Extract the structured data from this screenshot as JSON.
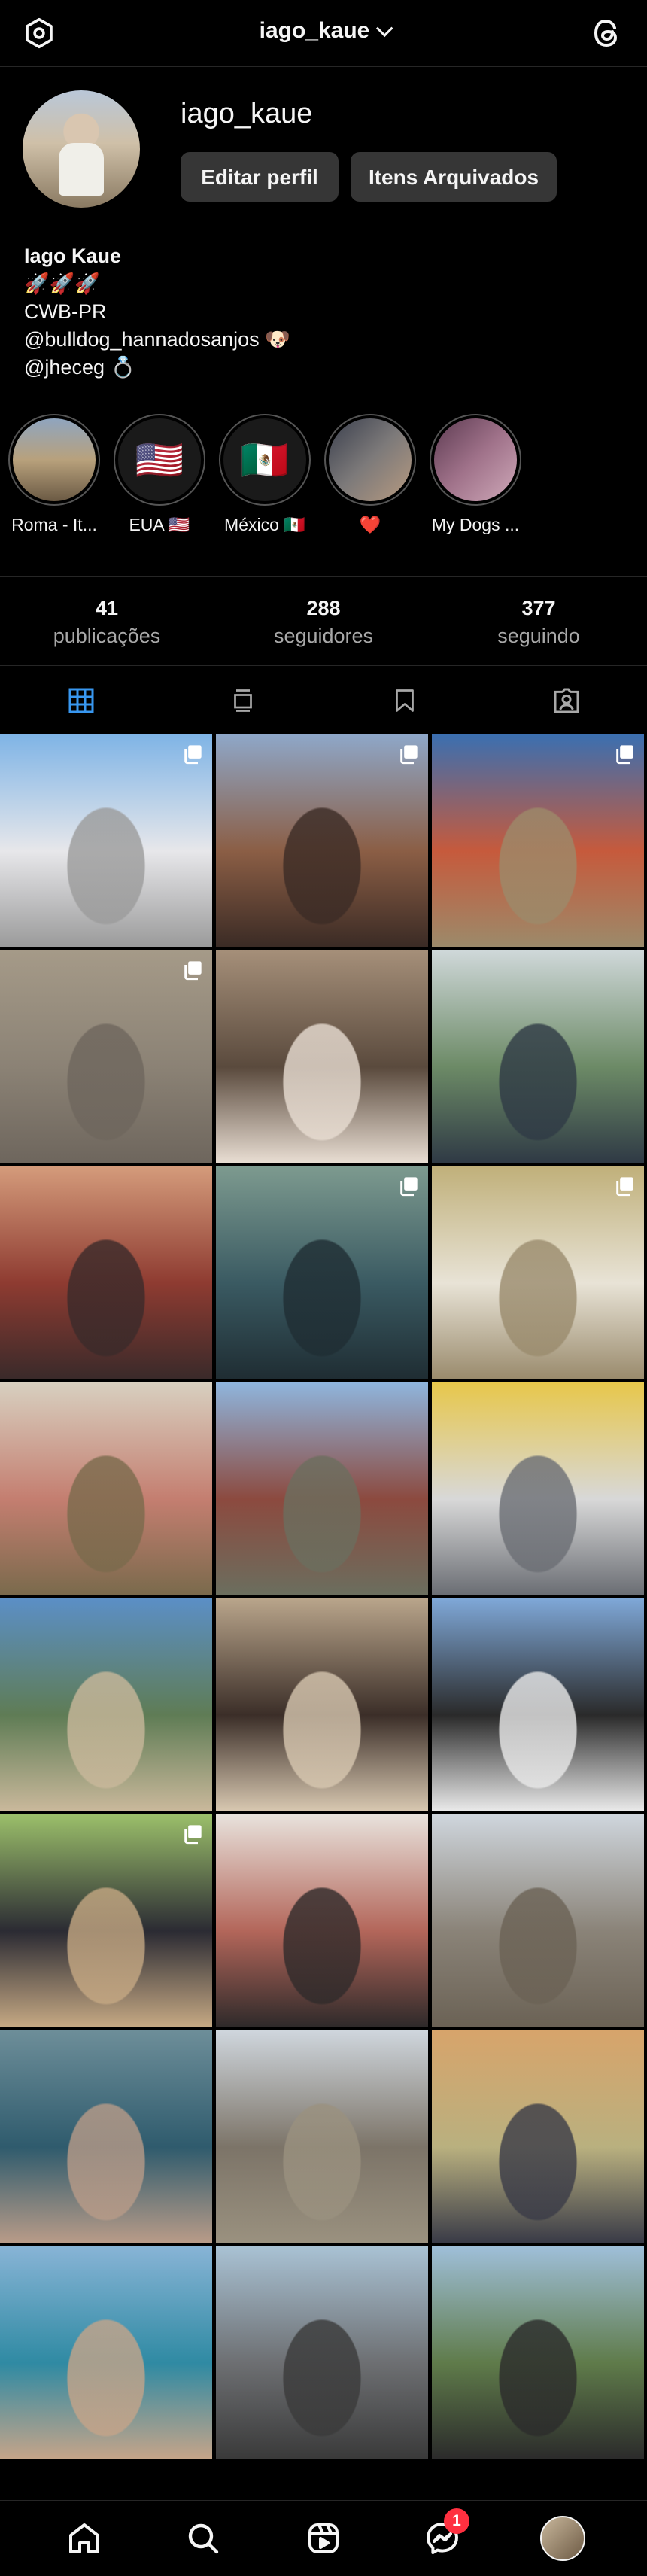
{
  "header": {
    "username": "iago_kaue",
    "settings_icon": "settings-gear-icon",
    "threads_icon": "threads-icon"
  },
  "profile": {
    "username": "iago_kaue",
    "edit_button": "Editar perfil",
    "archive_button": "Itens Arquivados",
    "bio": {
      "name": "Iago Kaue",
      "line1": "🚀🚀🚀",
      "line2": "CWB-PR",
      "line3": "@bulldog_hannadosanjos 🐶",
      "line4": "@jheceg 💍"
    }
  },
  "highlights": [
    {
      "label": "Roma - It...",
      "colors": [
        "#6b5a44",
        "#b8a17c"
      ]
    },
    {
      "label": "EUA 🇺🇸",
      "flag": "🇺🇸"
    },
    {
      "label": "México 🇲🇽",
      "flag": "🇲🇽"
    },
    {
      "label": "❤️",
      "colors": [
        "#3a3f4d",
        "#b79a80"
      ]
    },
    {
      "label": "My Dogs ...",
      "colors": [
        "#5d3b52",
        "#cfa9b9"
      ]
    }
  ],
  "stats": {
    "posts": {
      "value": "41",
      "label": "publicações"
    },
    "followers": {
      "value": "288",
      "label": "seguidores"
    },
    "following": {
      "value": "377",
      "label": "seguindo"
    }
  },
  "tabs": [
    "grid-icon",
    "feed-icon",
    "saved-icon",
    "tagged-icon"
  ],
  "grid": [
    {
      "colors": [
        "#7fb4e6",
        "#e7e7ea",
        "#9b9b9b"
      ],
      "multi": true
    },
    {
      "colors": [
        "#8ea7c8",
        "#8b5e45",
        "#3b2b25"
      ],
      "multi": true
    },
    {
      "colors": [
        "#3b6fb0",
        "#c65a3c",
        "#9c8a6a"
      ],
      "multi": true
    },
    {
      "colors": [
        "#a59a88",
        "#8b8275",
        "#6e665d"
      ],
      "multi": true
    },
    {
      "colors": [
        "#a58f79",
        "#5a4a3d",
        "#e8ddd2"
      ],
      "multi": false
    },
    {
      "colors": [
        "#cfd8d9",
        "#6c8a66",
        "#2f3a45"
      ],
      "multi": false
    },
    {
      "colors": [
        "#d49b7b",
        "#8e3b31",
        "#3a2a2a"
      ],
      "multi": false
    },
    {
      "colors": [
        "#7d9a8f",
        "#3a5a62",
        "#1f2d33"
      ],
      "multi": true
    },
    {
      "colors": [
        "#c0b07a",
        "#e8e3d6",
        "#9a8b6d"
      ],
      "multi": true
    },
    {
      "colors": [
        "#d8d0c0",
        "#c47e70",
        "#7a6a4c"
      ],
      "multi": false
    },
    {
      "colors": [
        "#8fb5dd",
        "#8c4a3f",
        "#6b6e5e"
      ],
      "multi": false
    },
    {
      "colors": [
        "#e7c74b",
        "#d8d8d8",
        "#6b6e74"
      ],
      "multi": false
    },
    {
      "colors": [
        "#5b8fc6",
        "#5f7c55",
        "#c9b89b"
      ],
      "multi": false
    },
    {
      "colors": [
        "#b9a58b",
        "#3b2e28",
        "#d7c7b0"
      ],
      "multi": false
    },
    {
      "colors": [
        "#7fa8d8",
        "#2a2a2a",
        "#e9e9e9"
      ],
      "multi": false
    },
    {
      "colors": [
        "#9bbf6a",
        "#2b2b33",
        "#c5a883"
      ],
      "multi": true
    },
    {
      "colors": [
        "#e8e2dc",
        "#b3665a",
        "#2f2a2a"
      ],
      "multi": false
    },
    {
      "colors": [
        "#cfd6dd",
        "#8a8378",
        "#6b6255"
      ],
      "multi": false
    },
    {
      "colors": [
        "#6d8e99",
        "#2f5b6d",
        "#b89b88"
      ],
      "multi": false
    },
    {
      "colors": [
        "#cfd6dd",
        "#7c7468",
        "#9a917f"
      ],
      "multi": false
    },
    {
      "colors": [
        "#d7a46b",
        "#b9b07f",
        "#3a3b47"
      ],
      "multi": false
    },
    {
      "colors": [
        "#88b4d6",
        "#2f8aa3",
        "#c5a489"
      ],
      "multi": false
    },
    {
      "colors": [
        "#a9c2d4",
        "#6d6f72",
        "#3a3a3a"
      ],
      "multi": false
    },
    {
      "colors": [
        "#9fbfd9",
        "#5f7b4a",
        "#2b2b2b"
      ],
      "multi": false
    }
  ],
  "bottom_nav": {
    "items": [
      "home-icon",
      "search-icon",
      "reels-icon",
      "messenger-icon",
      "profile-avatar"
    ],
    "messages_badge": "1"
  }
}
